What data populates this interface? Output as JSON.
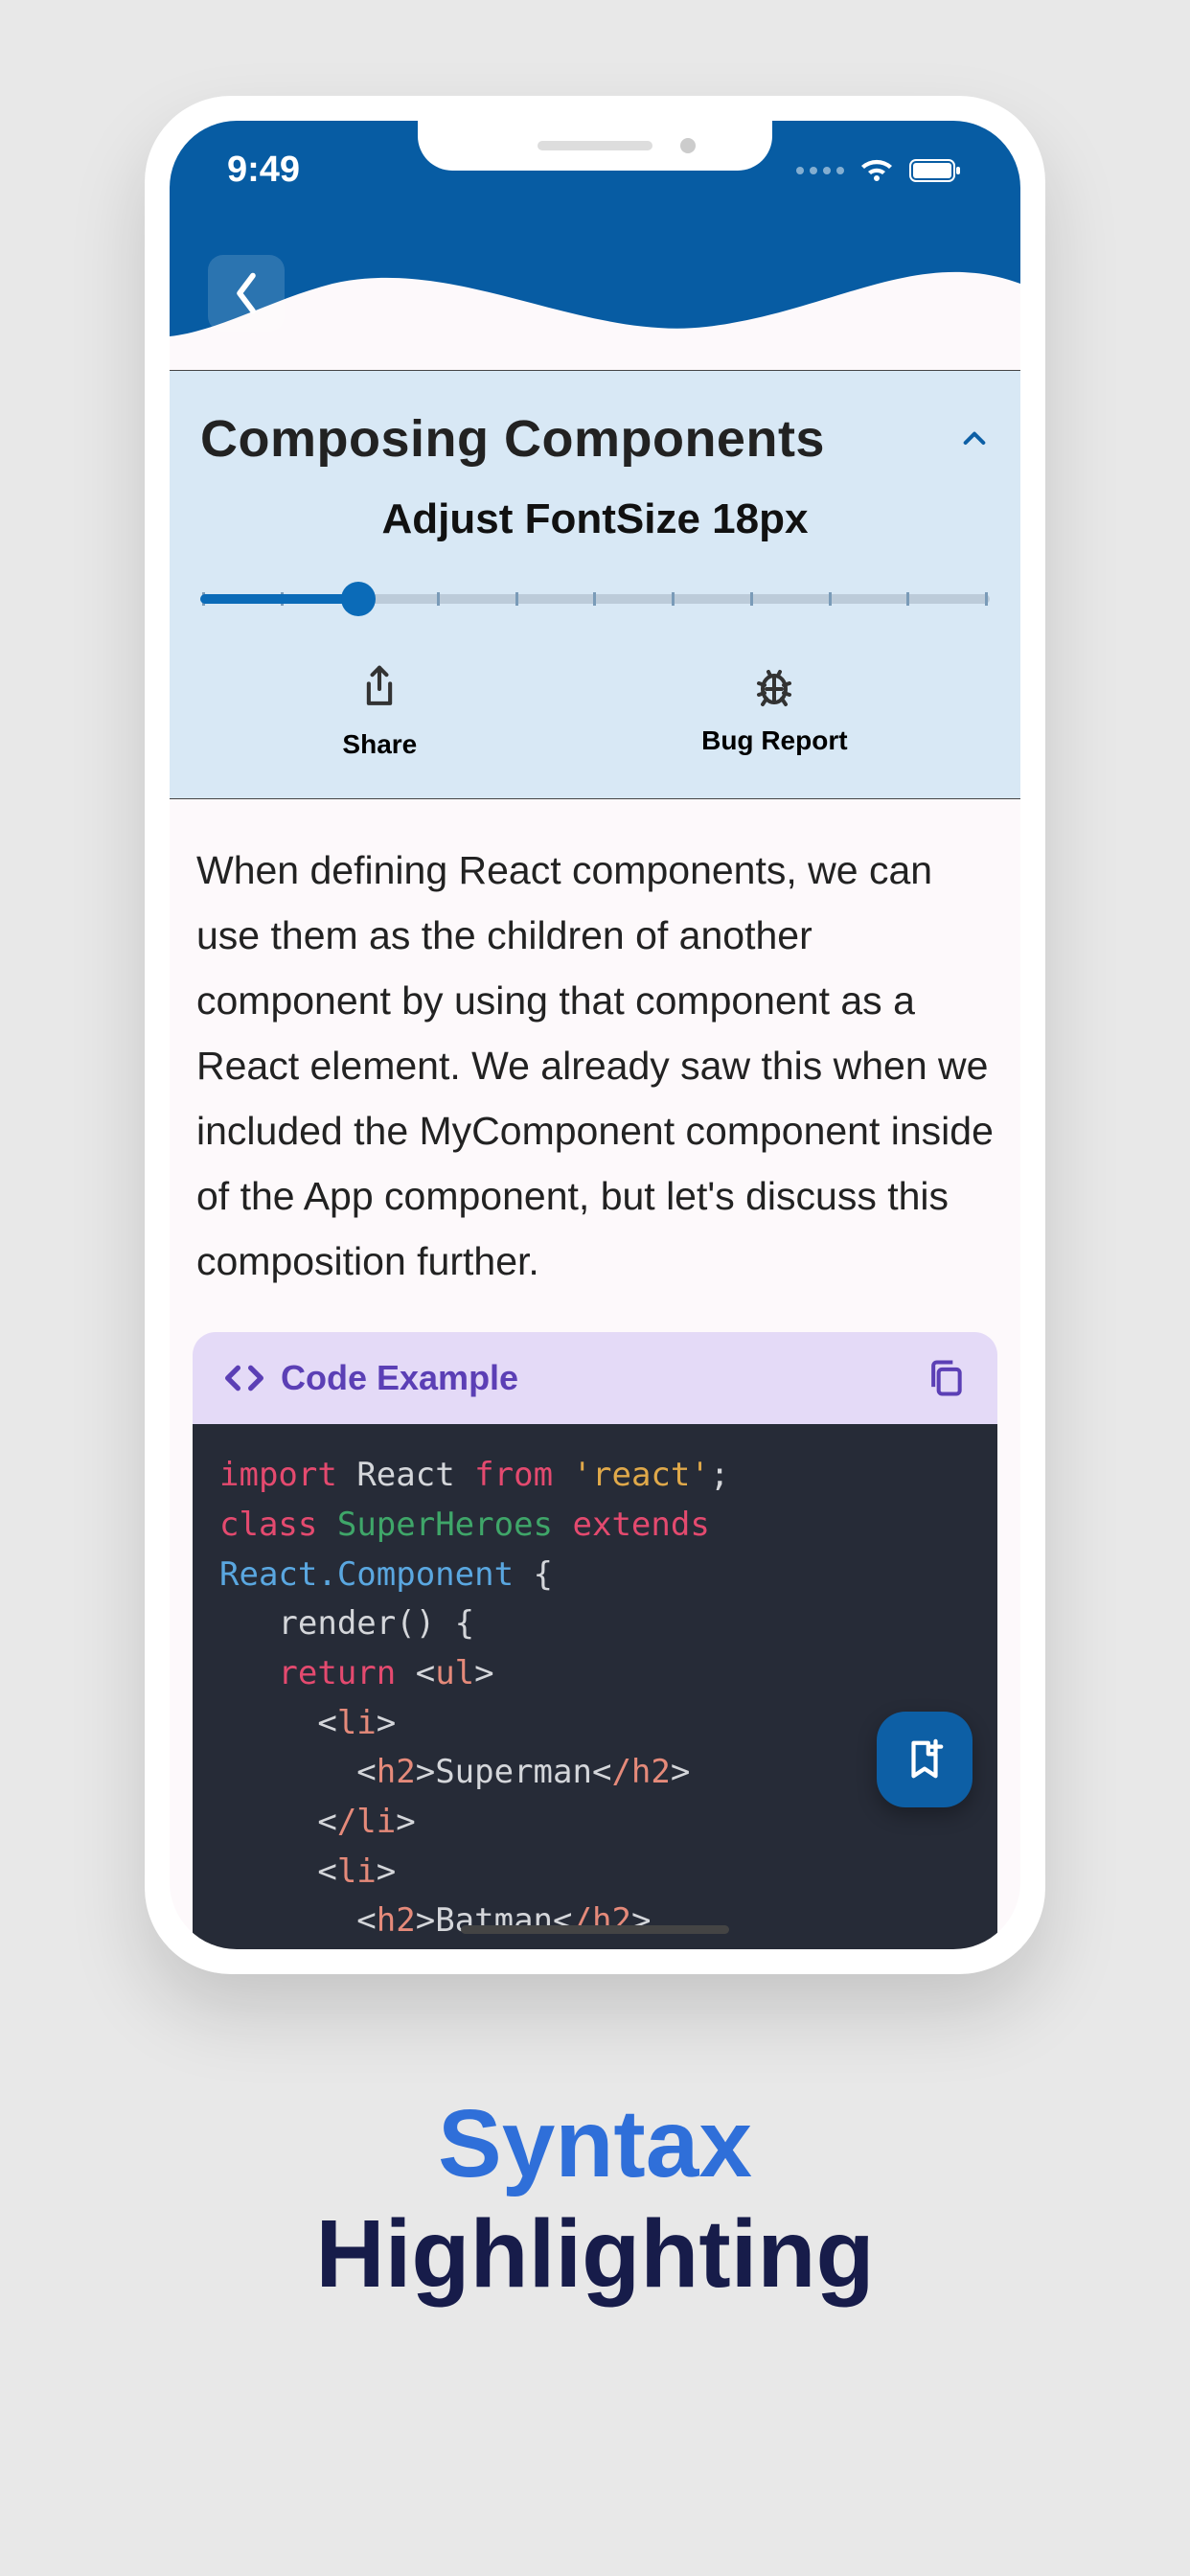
{
  "status": {
    "time": "9:49"
  },
  "panel": {
    "title": "Composing Components",
    "fontsize_label": "Adjust FontSize 18px",
    "share_label": "Share",
    "bug_label": "Bug Report"
  },
  "body": "When defining React components, we can use them as the children of another component by using that component as a React element. We already saw this when we included the MyComponent component inside of the App component, but let's discuss this composition further.",
  "code": {
    "header": "Code Example",
    "tokens": {
      "import": "import",
      "react": "React",
      "from": "from",
      "reactstr": "'react'",
      "class": "class",
      "superh": "SuperHeroes",
      "extends": "extends",
      "reactcomp": "React.Component",
      "render": "render() {",
      "return": "return",
      "ul": "ul",
      "li": "li",
      "cli": "/li",
      "h2": "h2",
      "ch2": "/h2",
      "superman": "Superman",
      "batman": "Batman"
    }
  },
  "marketing": {
    "line1": "Syntax",
    "line2": "Highlighting"
  }
}
